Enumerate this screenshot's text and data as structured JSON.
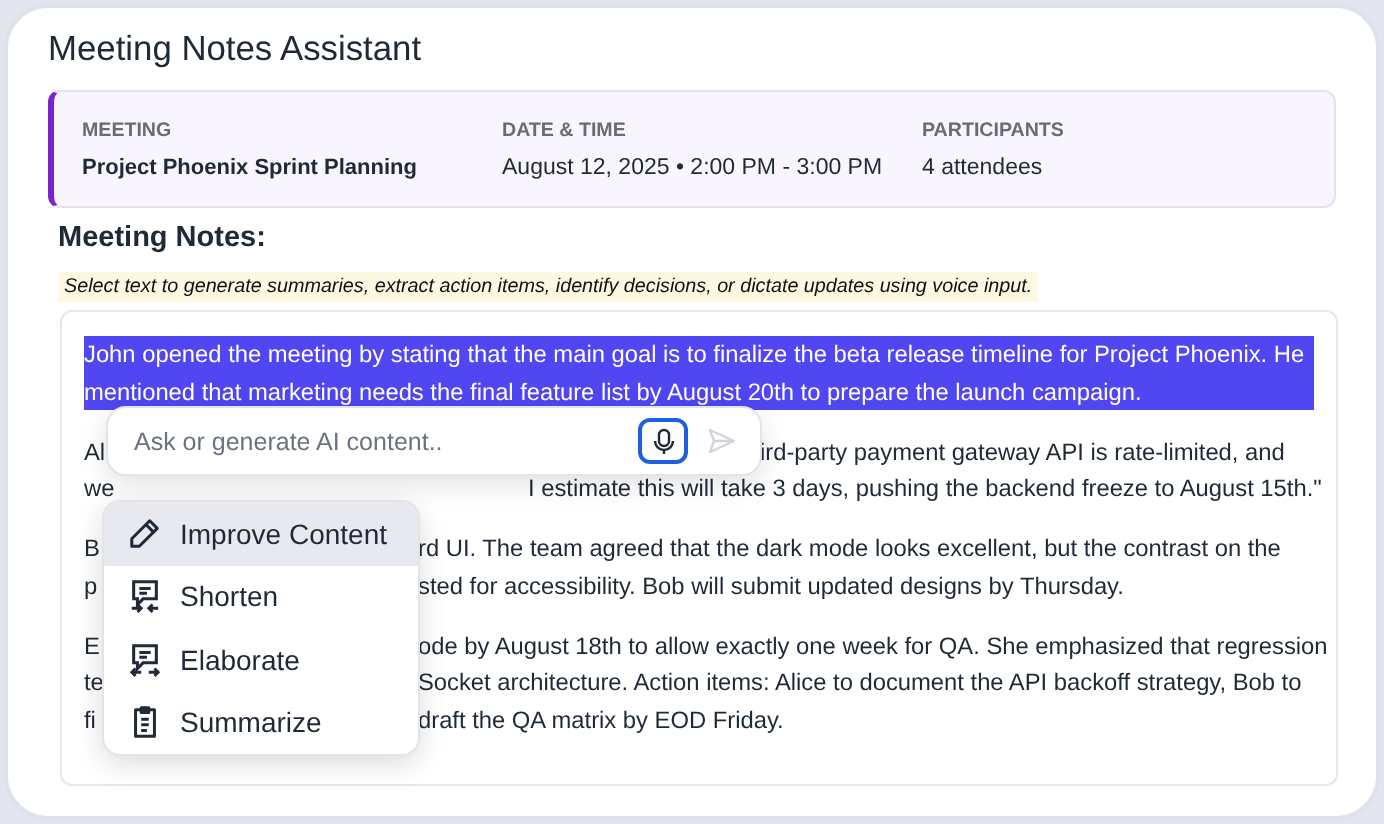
{
  "title": "Meeting Notes Assistant",
  "meeting": [
    {
      "label": "MEETING",
      "value": "Project Phoenix Sprint Planning",
      "kind": "bold"
    },
    {
      "label": "DATE & TIME",
      "value": "August 12, 2025 • 2:00 PM - 3:00 PM",
      "kind": "plain"
    },
    {
      "label": "PARTICIPANTS",
      "value": "4 attendees",
      "kind": "plain"
    }
  ],
  "notes_heading": "Meeting Notes:",
  "hint": "Select text to generate summaries, extract action items, identify decisions, or dictate updates using voice input.",
  "paragraphs": [
    {
      "selected": true,
      "lines": [
        {
          "lead": "John opened the meeting by stating that the main goal is to finalize the beta release timeline for Project Phoenix. He",
          "kind": "full"
        },
        {
          "lead": "mentioned that marketing needs the final feature list by August 20th to prepare the launch campaign.",
          "kind": "full"
        }
      ]
    },
    {
      "selected": false,
      "lines": [
        {
          "lead": "Al",
          "tail": "ird-party payment gateway API is rate-limited, and",
          "kind": "input"
        },
        {
          "lead": "we",
          "tail": "I estimate this will take 3 days, pushing the backend freeze to August 15th.\"",
          "kind": "shadow"
        }
      ]
    },
    {
      "selected": false,
      "lines": [
        {
          "lead": "B",
          "tail": "rd UI. The team agreed that the dark mode looks excellent, but the contrast on the",
          "kind": "menu"
        },
        {
          "lead": "p",
          "tail": "sted for accessibility. Bob will submit updated designs by Thursday.",
          "kind": "menu"
        }
      ]
    },
    {
      "selected": false,
      "lines": [
        {
          "lead": "E",
          "tail": "ode by August 18th to allow exactly one week for QA. She emphasized that regression",
          "kind": "menu"
        },
        {
          "lead": "te",
          "tail": "Socket architecture. Action items: Alice to document the API backoff strategy, Bob to",
          "kind": "menu"
        },
        {
          "lead": "fi",
          "tail": "draft the QA matrix by EOD Friday.",
          "kind": "menu"
        }
      ]
    }
  ],
  "ai_prompt": {
    "placeholder": "Ask or generate AI content..",
    "mic_active": true,
    "send_disabled": true
  },
  "menu": [
    {
      "label": "Improve Content",
      "selected": true
    },
    {
      "label": "Shorten",
      "selected": false
    },
    {
      "label": "Elaborate",
      "selected": false
    },
    {
      "label": "Summarize",
      "selected": false
    }
  ]
}
